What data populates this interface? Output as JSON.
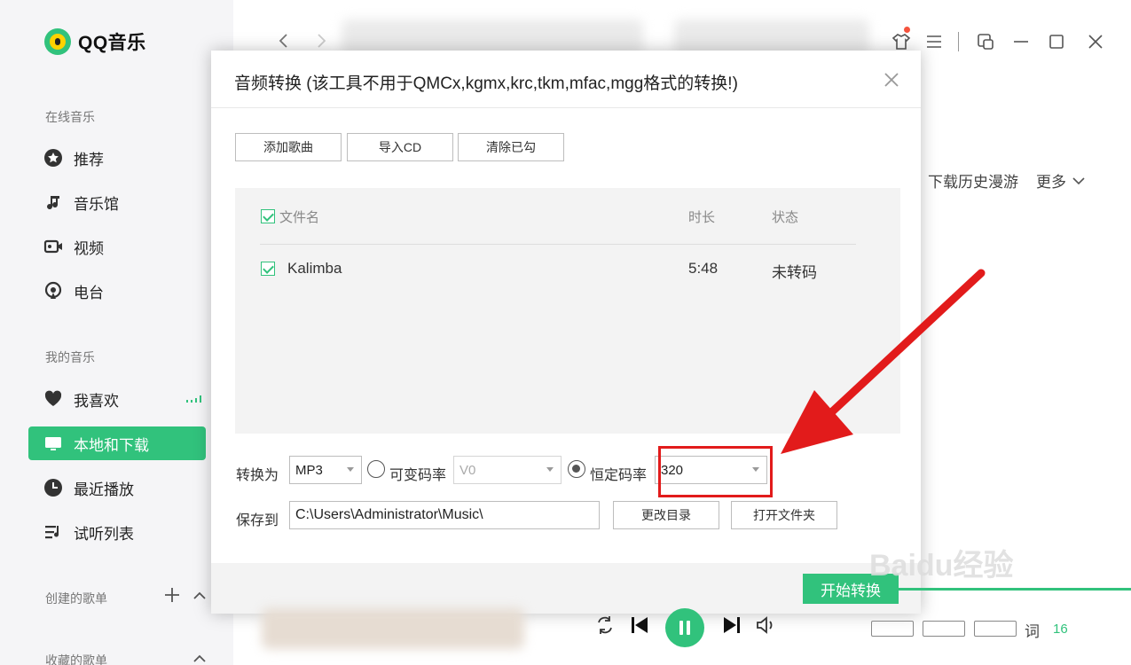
{
  "app": {
    "name": "QQ音乐"
  },
  "sidebar": {
    "online_section": "在线音乐",
    "mine_section": "我的音乐",
    "created_section": "创建的歌单",
    "collected_section": "收藏的歌单",
    "online_items": [
      {
        "label": "推荐",
        "icon": "star-icon"
      },
      {
        "label": "音乐馆",
        "icon": "music-note-icon"
      },
      {
        "label": "视频",
        "icon": "video-icon"
      },
      {
        "label": "电台",
        "icon": "radio-icon"
      }
    ],
    "mine_items": [
      {
        "label": "我喜欢",
        "icon": "heart-icon"
      },
      {
        "label": "本地和下载",
        "icon": "monitor-icon",
        "active": true
      },
      {
        "label": "最近播放",
        "icon": "clock-icon"
      },
      {
        "label": "试听列表",
        "icon": "playlist-icon"
      }
    ]
  },
  "topbar": {
    "tab_history": "下载历史漫游",
    "tab_more": "更多"
  },
  "dialog": {
    "title": "音频转换 (该工具不用于QMCx,kgmx,krc,tkm,mfac,mgg格式的转换!)",
    "buttons": {
      "add_song": "添加歌曲",
      "import_cd": "导入CD",
      "clear_checked": "清除已勾"
    },
    "columns": {
      "filename": "文件名",
      "duration": "时长",
      "status": "状态"
    },
    "rows": [
      {
        "filename": "Kalimba",
        "duration": "5:48",
        "status": "未转码",
        "checked": true
      }
    ],
    "convert_label": "转换为",
    "format_value": "MP3",
    "vbr_label": "可变码率",
    "vbr_value": "V0",
    "cbr_label": "恒定码率",
    "cbr_value": "320",
    "save_label": "保存到",
    "save_path": "C:\\Users\\Administrator\\Music\\",
    "change_dir": "更改目录",
    "open_folder": "打开文件夹",
    "start": "开始转换"
  },
  "player": {
    "lyrics_label": "词",
    "count": "16"
  },
  "watermark": "Baidu经验",
  "colors": {
    "accent": "#31c27c",
    "highlight": "#e21b1b"
  }
}
